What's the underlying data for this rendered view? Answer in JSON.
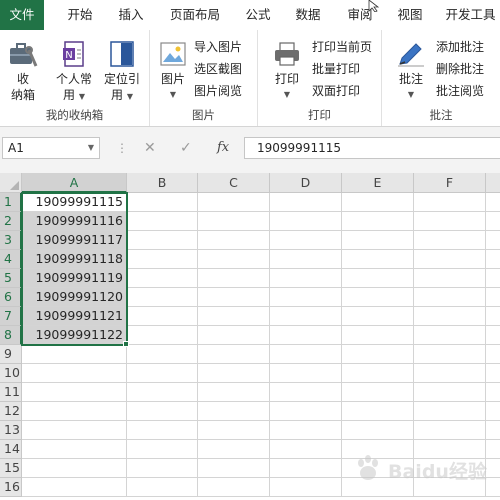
{
  "tabs": [
    "文件",
    "开始",
    "插入",
    "页面布局",
    "公式",
    "数据",
    "审阅",
    "视图",
    "开发工具"
  ],
  "ribbon": {
    "group_mybox": {
      "label": "我的收纳箱",
      "btn_box_line1": "收",
      "btn_box_line2": "纳箱",
      "btn_personal_line1": "个人常",
      "btn_personal_line2": "用",
      "btn_locate_line1": "定位引",
      "btn_locate_line2": "用"
    },
    "group_picture": {
      "label": "图片",
      "big": "图片",
      "import": "导入图片",
      "screenshot": "选区截图",
      "browse": "图片阅览"
    },
    "group_print": {
      "label": "打印",
      "big": "打印",
      "current": "打印当前页",
      "batch": "批量打印",
      "duplex": "双面打印"
    },
    "group_comment": {
      "label": "批注",
      "big": "批注",
      "add": "添加批注",
      "delete": "删除批注",
      "browse": "批注阅览"
    }
  },
  "formula_bar": {
    "name_box": "A1",
    "cancel_glyph": "✕",
    "confirm_glyph": "✓",
    "fx": "fx",
    "value": "19099991115"
  },
  "grid": {
    "columns": [
      "A",
      "B",
      "C",
      "D",
      "E",
      "F"
    ],
    "rows": [
      "1",
      "2",
      "3",
      "4",
      "5",
      "6",
      "7",
      "8",
      "9",
      "10",
      "11",
      "12",
      "13",
      "14",
      "15",
      "16"
    ],
    "column_a_values": [
      "19099991115",
      "19099991116",
      "19099991117",
      "19099991118",
      "19099991119",
      "19099991120",
      "19099991121",
      "19099991122"
    ]
  },
  "colors": {
    "accent": "#217346",
    "selection_fill": "#d3d3d3"
  }
}
